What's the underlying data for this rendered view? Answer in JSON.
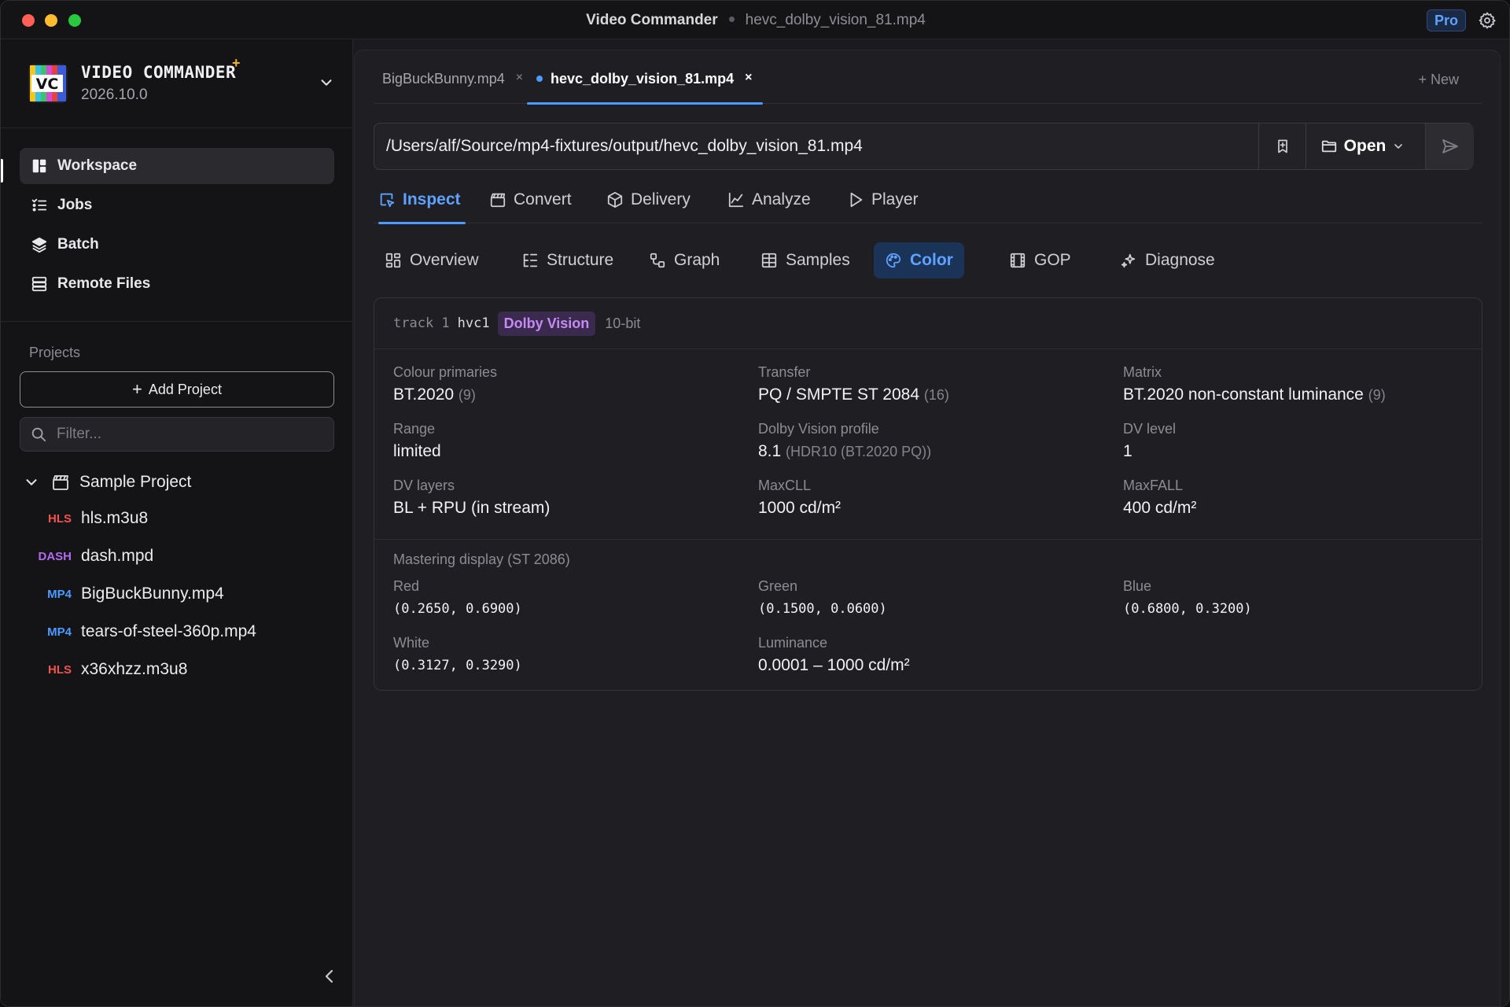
{
  "window": {
    "app_title": "Video Commander",
    "file_title": "hevc_dolby_vision_81.mp4",
    "pro_badge": "Pro"
  },
  "sidebar": {
    "brand_name": "VIDEO COMMANDER",
    "brand_star": "+",
    "version": "2026.10.0",
    "logo_text": "VC",
    "nav": [
      {
        "label": "Workspace",
        "icon": "workspace-icon",
        "active": true
      },
      {
        "label": "Jobs",
        "icon": "jobs-icon"
      },
      {
        "label": "Batch",
        "icon": "layers-icon"
      },
      {
        "label": "Remote Files",
        "icon": "server-icon"
      }
    ],
    "projects_label": "Projects",
    "add_project_label": "Add Project",
    "filter_placeholder": "Filter...",
    "project": {
      "name": "Sample Project",
      "files": [
        {
          "tag": "HLS",
          "name": "hls.m3u8"
        },
        {
          "tag": "DASH",
          "name": "dash.mpd"
        },
        {
          "tag": "MP4",
          "name": "BigBuckBunny.mp4"
        },
        {
          "tag": "MP4",
          "name": "tears-of-steel-360p.mp4"
        },
        {
          "tag": "HLS",
          "name": "x36xhzz.m3u8"
        }
      ]
    }
  },
  "file_tabs": [
    {
      "label": "BigBuckBunny.mp4",
      "close": "×"
    },
    {
      "label": "hevc_dolby_vision_81.mp4",
      "close": "×",
      "active": true
    }
  ],
  "new_tab_label": "+ New",
  "url": {
    "value": "/Users/alf/Source/mp4-fixtures/output/hevc_dolby_vision_81.mp4",
    "open_label": "Open"
  },
  "mode_tabs": [
    {
      "label": "Inspect",
      "icon": "inspect-icon",
      "active": true
    },
    {
      "label": "Convert",
      "icon": "clapper-icon"
    },
    {
      "label": "Delivery",
      "icon": "package-icon"
    },
    {
      "label": "Analyze",
      "icon": "chart-icon"
    },
    {
      "label": "Player",
      "icon": "play-icon"
    }
  ],
  "sub_tabs": [
    {
      "label": "Overview",
      "icon": "grid-icon"
    },
    {
      "label": "Structure",
      "icon": "tree-icon"
    },
    {
      "label": "Graph",
      "icon": "graph-icon"
    },
    {
      "label": "Samples",
      "icon": "table-icon"
    },
    {
      "label": "Color",
      "icon": "palette-icon",
      "active": true
    },
    {
      "label": "GOP",
      "icon": "film-icon"
    },
    {
      "label": "Diagnose",
      "icon": "sparkle-icon"
    }
  ],
  "track": {
    "track_label": "track 1",
    "codec": "hvc1",
    "badge": "Dolby Vision",
    "bit_depth": "10-bit"
  },
  "color_fields": {
    "colour_primaries": {
      "label": "Colour primaries",
      "value": "BT.2020",
      "code": "(9)"
    },
    "transfer": {
      "label": "Transfer",
      "value": "PQ / SMPTE ST 2084",
      "code": "(16)"
    },
    "matrix": {
      "label": "Matrix",
      "value": "BT.2020 non-constant luminance",
      "code": "(9)"
    },
    "range": {
      "label": "Range",
      "value": "limited"
    },
    "dv_profile": {
      "label": "Dolby Vision profile",
      "value": "8.1",
      "code": "(HDR10 (BT.2020 PQ))"
    },
    "dv_level": {
      "label": "DV level",
      "value": "1"
    },
    "dv_layers": {
      "label": "DV layers",
      "value": "BL + RPU (in stream)"
    },
    "maxcll": {
      "label": "MaxCLL",
      "value": "1000 cd/m²"
    },
    "maxfall": {
      "label": "MaxFALL",
      "value": "400 cd/m²"
    }
  },
  "mastering": {
    "title": "Mastering display (ST 2086)",
    "red": {
      "label": "Red",
      "value": "(0.2650, 0.6900)"
    },
    "green": {
      "label": "Green",
      "value": "(0.1500, 0.0600)"
    },
    "blue": {
      "label": "Blue",
      "value": "(0.6800, 0.3200)"
    },
    "white": {
      "label": "White",
      "value": "(0.3127, 0.3290)"
    },
    "luminance": {
      "label": "Luminance",
      "value": "0.0001 – 1000 cd/m²"
    }
  },
  "colors": {
    "accent": "#4c9bff",
    "dolby_badge_text": "#c58af5",
    "hls_tag": "#ef5350",
    "dash_tag": "#b46af0",
    "mp4_tag": "#4c9bff"
  }
}
